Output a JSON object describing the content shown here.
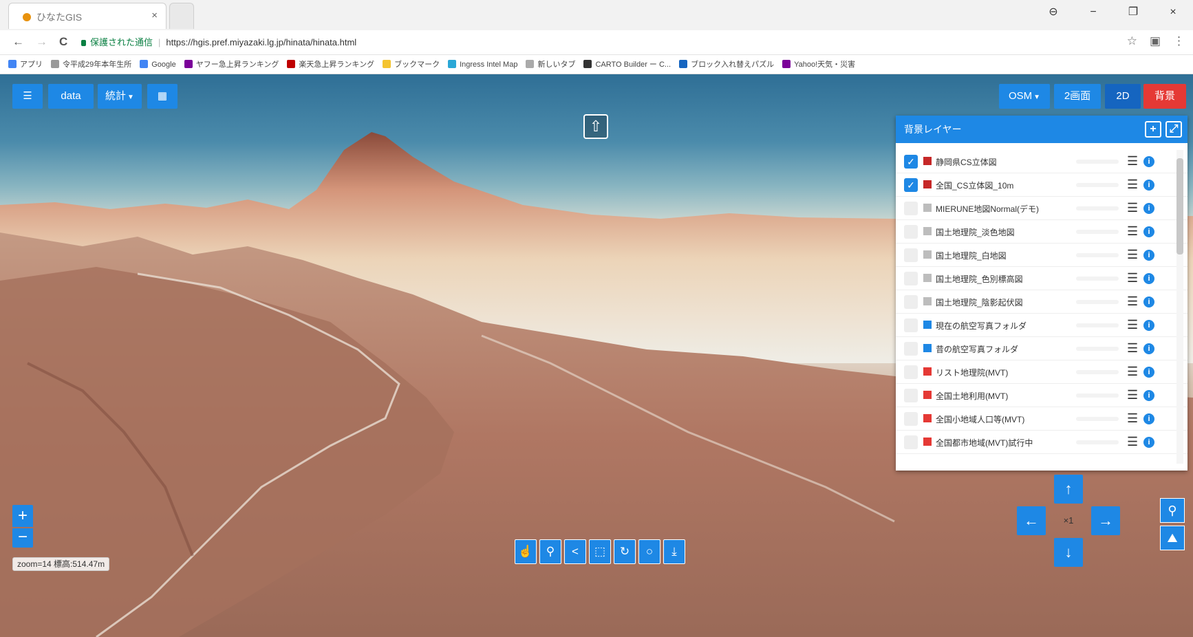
{
  "browser": {
    "tab_title": "ひなたGIS",
    "tab_close": "×",
    "window_controls": {
      "account": "⊖",
      "minimize": "−",
      "restore": "❐",
      "close": "×"
    },
    "nav": {
      "back": "←",
      "forward": "→",
      "reload": "C"
    },
    "secure_label": "保護された通信",
    "url": "https://hgis.pref.miyazaki.lg.jp/hinata/hinata.html",
    "star": "☆",
    "bookmarks": [
      {
        "label": "アプリ",
        "color": "#4285f4"
      },
      {
        "label": "令平成29年本年生所",
        "color": "#999999"
      },
      {
        "label": "Google",
        "color": "#4285f4"
      },
      {
        "label": "ヤフー急上昇ランキング",
        "color": "#7b0099"
      },
      {
        "label": "楽天急上昇ランキング",
        "color": "#bf0000"
      },
      {
        "label": "ブックマーク",
        "color": "#f4c430"
      },
      {
        "label": "Ingress Intel Map",
        "color": "#2aa7d6"
      },
      {
        "label": "新しいタブ",
        "color": "#aaaaaa"
      },
      {
        "label": "CARTO Builder ー C...",
        "color": "#333333"
      },
      {
        "label": "ブロック入れ替えパズル",
        "color": "#1565c0"
      },
      {
        "label": "Yahoo!天気・災害",
        "color": "#7b0099"
      }
    ]
  },
  "toolbar_left": {
    "menu_label": "☰",
    "data_label": "data",
    "stats_label": "統計",
    "calendar_label": "▦"
  },
  "toolbar_right": {
    "osm_label": "OSM",
    "split_label": "2画面",
    "mode_label": "2D",
    "bg_label": "背景"
  },
  "north_arrow": "⇧",
  "layer_panel": {
    "title": "背景レイヤー",
    "add_label": "+",
    "maximize_label": "⤢",
    "layers": [
      {
        "name": "静岡県CS立体図",
        "checked": true,
        "icon_color": "#c62828"
      },
      {
        "name": "全国_CS立体図_10m",
        "checked": true,
        "icon_color": "#c62828"
      },
      {
        "name": "MIERUNE地図Normal(デモ)",
        "checked": false,
        "icon_color": "#bdbdbd"
      },
      {
        "name": "国土地理院_淡色地図",
        "checked": false,
        "icon_color": "#bdbdbd"
      },
      {
        "name": "国土地理院_白地図",
        "checked": false,
        "icon_color": "#bdbdbd"
      },
      {
        "name": "国土地理院_色別標高図",
        "checked": false,
        "icon_color": "#bdbdbd"
      },
      {
        "name": "国土地理院_陰影起伏図",
        "checked": false,
        "icon_color": "#bdbdbd"
      },
      {
        "name": "現在の航空写真フォルダ",
        "checked": false,
        "icon_color": "#1e88e5"
      },
      {
        "name": "昔の航空写真フォルダ",
        "checked": false,
        "icon_color": "#1e88e5"
      },
      {
        "name": "リスト地理院(MVT)",
        "checked": false,
        "icon_color": "#e53935"
      },
      {
        "name": "全国土地利用(MVT)",
        "checked": false,
        "icon_color": "#e53935"
      },
      {
        "name": "全国小地域人口等(MVT)",
        "checked": false,
        "icon_color": "#e53935"
      },
      {
        "name": "全国都市地域(MVT)試行中",
        "checked": false,
        "icon_color": "#e53935"
      }
    ],
    "menu_glyph": "☰",
    "info_glyph": "i"
  },
  "zoom": {
    "in_label": "+",
    "out_label": "−",
    "readout": "zoom=14 標高:514.47m"
  },
  "bottom_tools": [
    {
      "name": "hand-pointer",
      "glyph": "☝"
    },
    {
      "name": "pin",
      "glyph": "⚲"
    },
    {
      "name": "share",
      "glyph": "<"
    },
    {
      "name": "polygon",
      "glyph": "⬚"
    },
    {
      "name": "rotate",
      "glyph": "↻"
    },
    {
      "name": "circle",
      "glyph": "○"
    },
    {
      "name": "download",
      "glyph": "⤓"
    }
  ],
  "dpad": {
    "up": "↑",
    "down": "↓",
    "left": "←",
    "right": "→",
    "center": "×1"
  },
  "side_buttons": {
    "pin": "⚲",
    "terrain": "⛰"
  }
}
